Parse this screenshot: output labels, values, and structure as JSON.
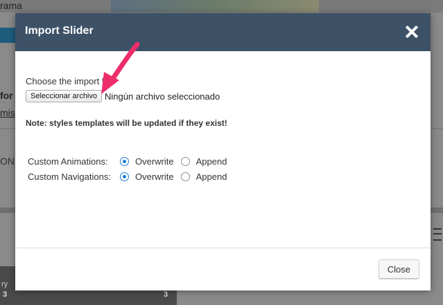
{
  "background": {
    "top_text": "rama",
    "left_text_1": "for",
    "left_text_2": "mis",
    "left_text_3": "ON",
    "bottom_left_text": "ry",
    "bottom_num_1": "3",
    "bottom_num_2": "3"
  },
  "modal": {
    "title": "Import Slider",
    "choose_label": "Choose the import file",
    "file_button_label": "Seleccionar archivo",
    "file_status": "Ningún archivo seleccionado",
    "note": "Note: styles templates will be updated if they exist!",
    "options": [
      {
        "label": "Custom Animations:",
        "choices": [
          "Overwrite",
          "Append"
        ],
        "selected": "Overwrite"
      },
      {
        "label": "Custom Navigations:",
        "choices": [
          "Overwrite",
          "Append"
        ],
        "selected": "Overwrite"
      }
    ],
    "close_button_label": "Close"
  },
  "colors": {
    "header": "#3d5167",
    "radio_accent": "#1e7fd6",
    "annotation_arrow": "#ee2e6b"
  }
}
